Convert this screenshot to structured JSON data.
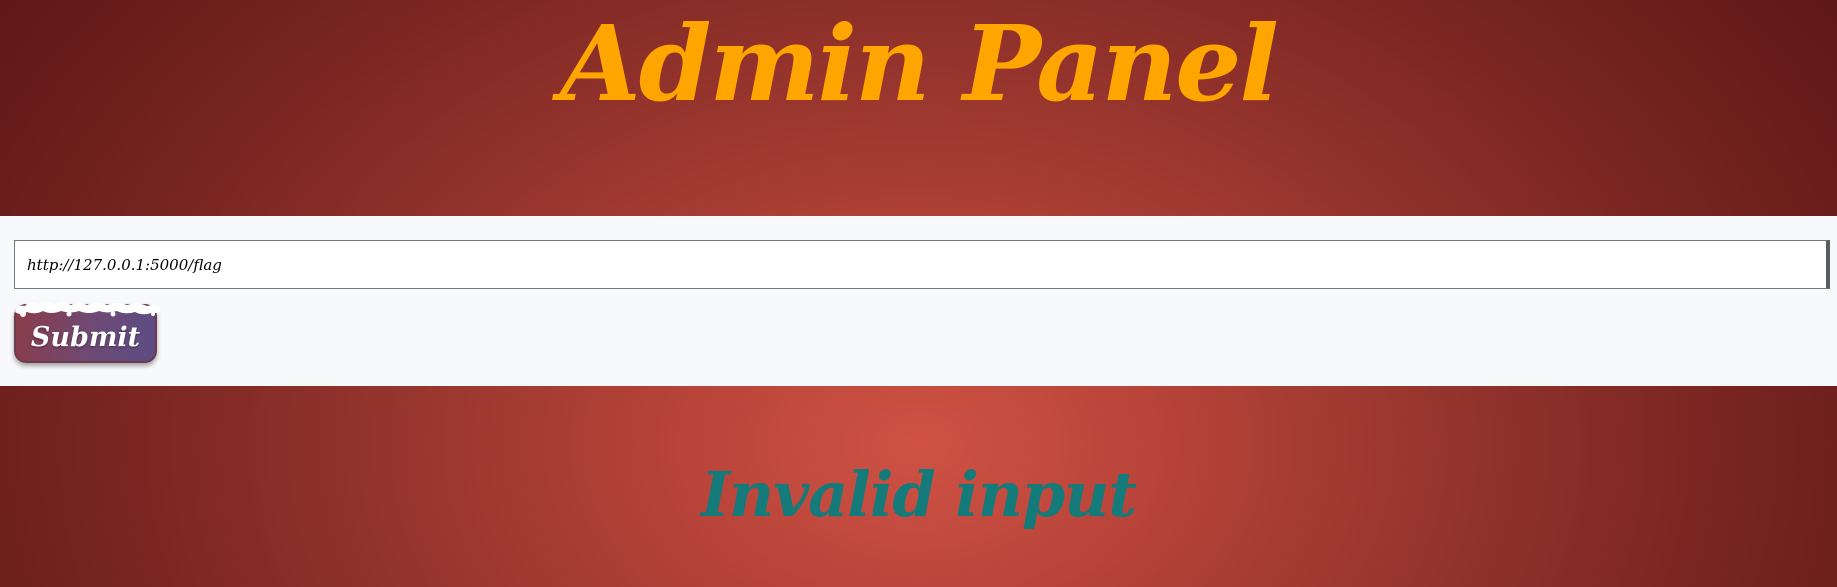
{
  "header": {
    "title": "Admin Panel",
    "title_color": "#ffa500"
  },
  "form": {
    "url_value": "http://127.0.0.1:5000/flag",
    "submit_label": "Submit"
  },
  "result": {
    "message": "Invalid input",
    "message_color": "#147a7a"
  },
  "colors": {
    "background_center": "#cf5244",
    "background_edge": "#5a1615",
    "form_band": "#f8f9fa",
    "button_start": "#8c3c48",
    "button_end": "#5b4d84"
  }
}
